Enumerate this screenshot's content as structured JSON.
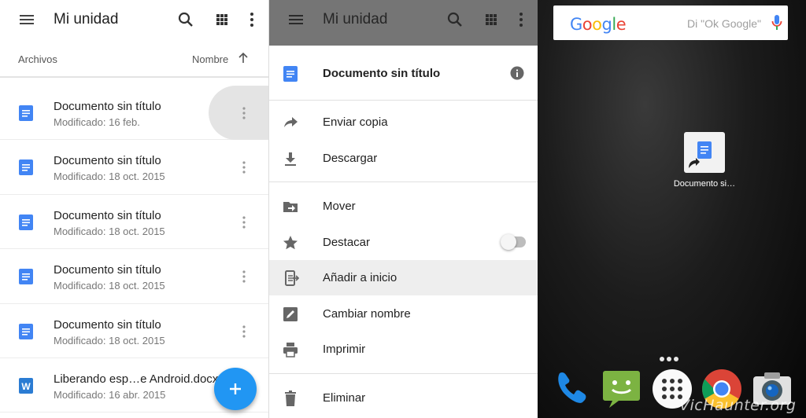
{
  "drive": {
    "title": "Mi unidad",
    "section_label": "Archivos",
    "sort_label": "Nombre",
    "files": [
      {
        "name": "Documento sin título",
        "meta": "Modificado: 16 feb.",
        "type": "doc"
      },
      {
        "name": "Documento sin título",
        "meta": "Modificado: 18 oct. 2015",
        "type": "doc"
      },
      {
        "name": "Documento sin título",
        "meta": "Modificado: 18 oct. 2015",
        "type": "doc"
      },
      {
        "name": "Documento sin título",
        "meta": "Modificado: 18 oct. 2015",
        "type": "doc"
      },
      {
        "name": "Documento sin título",
        "meta": "Modificado: 18 oct. 2015",
        "type": "doc"
      },
      {
        "name": "Liberando esp…e Android.docx",
        "meta": "Modificado: 16 abr. 2015",
        "type": "word"
      }
    ],
    "word_badge": "W"
  },
  "sheet": {
    "title": "Mi unidad",
    "doc_name": "Documento sin título",
    "items": {
      "send": "Enviar copia",
      "download": "Descargar",
      "move": "Mover",
      "star": "Destacar",
      "add_home": "Añadir a inicio",
      "rename": "Cambiar nombre",
      "print": "Imprimir",
      "delete": "Eliminar"
    }
  },
  "home": {
    "google_logo": [
      "G",
      "o",
      "o",
      "g",
      "l",
      "e"
    ],
    "search_hint": "Di \"Ok Google\"",
    "shortcut_label": "Documento si…",
    "watermark": "VicHaunter.org"
  },
  "colors": {
    "accent": "#2196f3",
    "doc_blue": "#4285f4",
    "google": [
      "#4285f4",
      "#ea4335",
      "#fbbc05",
      "#4285f4",
      "#34a853",
      "#ea4335"
    ]
  }
}
